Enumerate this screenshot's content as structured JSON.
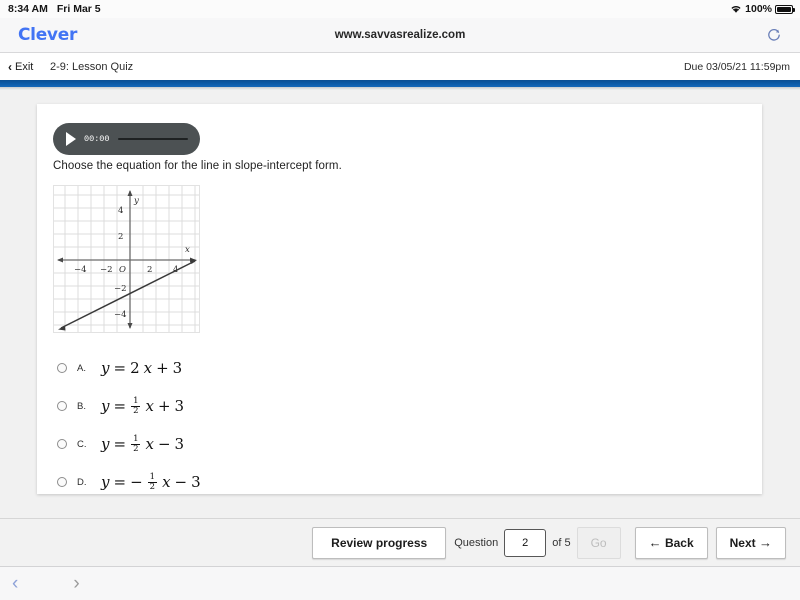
{
  "status_bar": {
    "time": "8:34 AM",
    "date": "Fri Mar 5",
    "wifi_icon": "wifi-icon",
    "battery_percent": "100%",
    "battery_icon": "battery-full-icon"
  },
  "browser": {
    "logo": "Clever",
    "url": "www.savvasrealize.com",
    "reload_icon": "reload-icon",
    "back_chevron": "‹",
    "forward_chevron": "›"
  },
  "app_header": {
    "exit_chevron": "‹",
    "exit_label": "Exit",
    "lesson_title": "2-9: Lesson Quiz",
    "due_text": "Due 03/05/21 11:59pm",
    "accent_color": "#0d5ca9"
  },
  "question": {
    "audio": {
      "play_icon": "play-icon",
      "time": "00:00"
    },
    "stem": "Choose the equation for the line in slope-intercept form.",
    "graph": {
      "x_ticks": [
        "-4",
        "-2",
        "2",
        "4"
      ],
      "y_ticks": [
        "4",
        "2",
        "-2",
        "-4"
      ],
      "origin_label": "O",
      "x_axis_label": "x",
      "y_axis_label": "y",
      "line_slope": "1/2",
      "line_intercept": "-3",
      "grid_min": -6,
      "grid_max": 6
    },
    "choices": [
      {
        "letter": "A.",
        "selected": false,
        "parts": [
          {
            "t": "y",
            "it": true
          },
          {
            "t": "="
          },
          {
            "t": "2",
            "it": false
          },
          {
            "t": "x",
            "it": true
          },
          {
            "t": "+"
          },
          {
            "t": "3"
          }
        ]
      },
      {
        "letter": "B.",
        "selected": false,
        "parts": [
          {
            "t": "y",
            "it": true
          },
          {
            "t": "="
          },
          {
            "frac": [
              "1",
              "2"
            ]
          },
          {
            "t": "x",
            "it": true
          },
          {
            "t": "+"
          },
          {
            "t": "3"
          }
        ]
      },
      {
        "letter": "C.",
        "selected": false,
        "parts": [
          {
            "t": "y",
            "it": true
          },
          {
            "t": "="
          },
          {
            "frac": [
              "1",
              "2"
            ]
          },
          {
            "t": "x",
            "it": true
          },
          {
            "t": "−"
          },
          {
            "t": "3"
          }
        ]
      },
      {
        "letter": "D.",
        "selected": false,
        "parts": [
          {
            "t": "y",
            "it": true
          },
          {
            "t": "="
          },
          {
            "t": "−"
          },
          {
            "frac": [
              "1",
              "2"
            ]
          },
          {
            "t": "x",
            "it": true
          },
          {
            "t": "−"
          },
          {
            "t": "3"
          }
        ]
      }
    ]
  },
  "bottom_bar": {
    "review_label": "Review progress",
    "question_label": "Question",
    "question_value": "2",
    "of_label": "of 5",
    "go_label": "Go",
    "go_disabled": true,
    "back_label": "Back",
    "back_arrow": "←",
    "next_label": "Next",
    "next_arrow": "→"
  }
}
